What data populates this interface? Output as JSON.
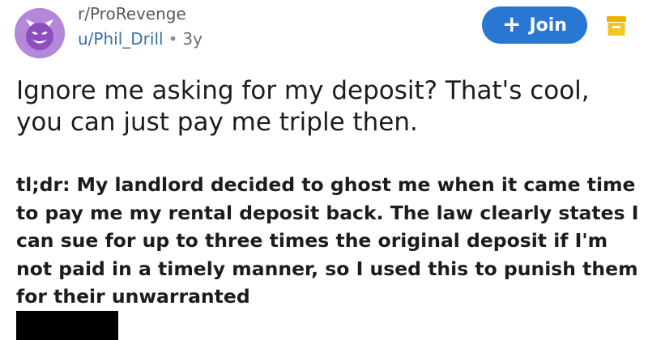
{
  "post": {
    "subreddit": "r/ProRevenge",
    "username": "u/Phil_Drill",
    "separator": "•",
    "age": "3y",
    "title": "Ignore me asking for my deposit? That's cool, you can just pay me triple then.",
    "body": "tl;dr: My landlord decided to ghost me when it came time to pay me my rental deposit back. The law clearly states I can sue for up to three times the original deposit if I'm not paid in a timely manner, so I used this to punish them for their unwarranted"
  },
  "actions": {
    "join_label": "Join",
    "join_icon": "plus-icon"
  },
  "icons": {
    "avatar": "purple-devil-avatar-icon",
    "save": "folder-icon"
  },
  "colors": {
    "join_button": "#2878d3",
    "username": "#3a6ea8",
    "avatar": "#b388d9",
    "folder": "#e8b400"
  }
}
